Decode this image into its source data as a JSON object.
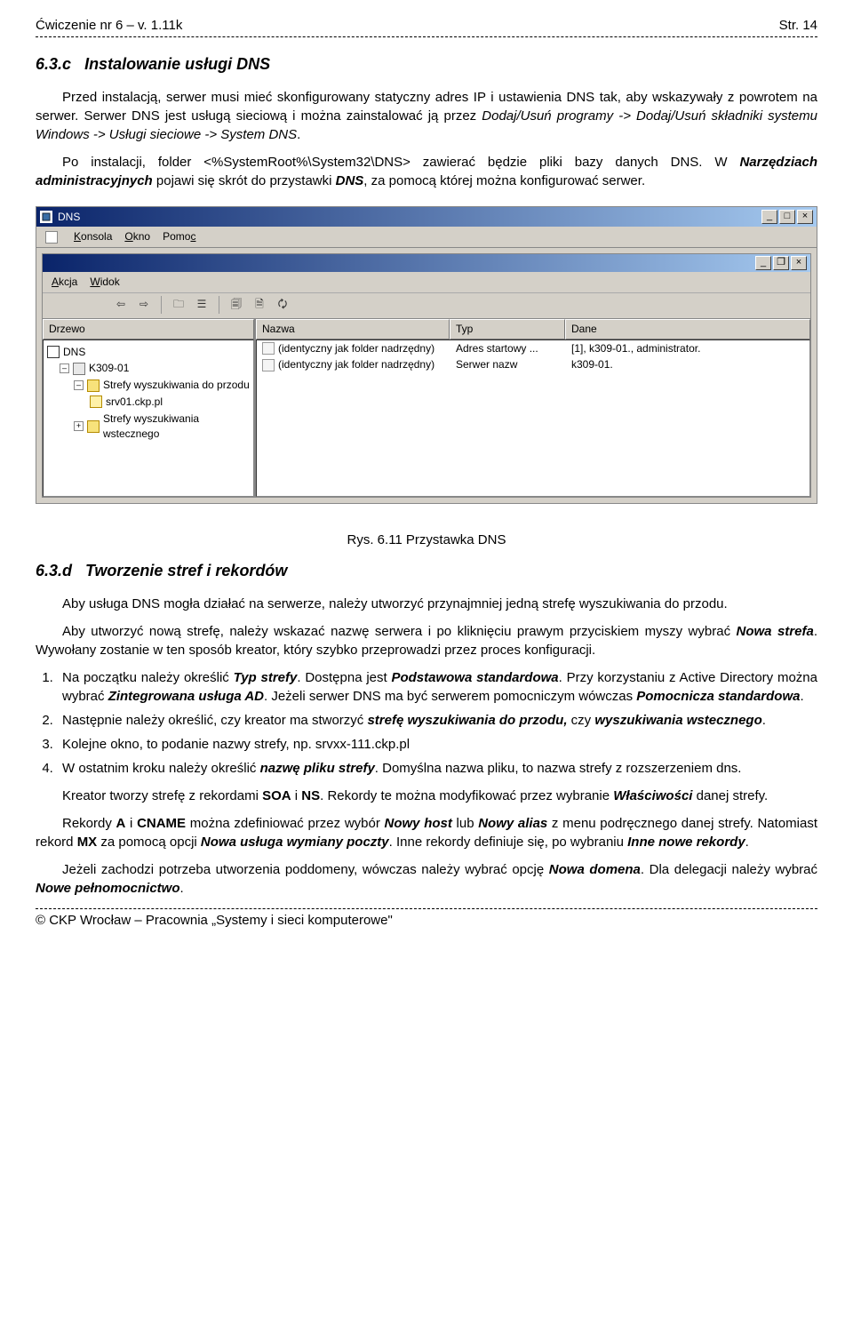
{
  "header": {
    "left": "Ćwiczenie nr 6 – v. 1.11k",
    "right": "Str. 14"
  },
  "section_c": {
    "number": "6.3.c",
    "title": "Instalowanie usługi DNS",
    "p1a": "Przed instalacją, serwer musi mieć skonfigurowany statyczny adres IP i ustawienia DNS tak, aby wskazywały z powrotem na serwer. Serwer DNS jest usługą sieciową i można zainstalować ją przez ",
    "p1b": "Dodaj/Usuń programy -> Dodaj/Usuń składniki systemu Windows -> Usługi sieciowe -> System DNS",
    "p1c": ".",
    "p2a": "Po instalacji, folder <%SystemRoot%\\System32\\DNS> zawierać będzie pliki bazy danych DNS. W ",
    "p2b": "Narzędziach administracyjnych",
    "p2c": " pojawi się skrót do przystawki ",
    "p2d": "DNS",
    "p2e": ", za pomocą której można konfigurować serwer."
  },
  "window": {
    "title": "DNS",
    "menu1": {
      "konsola": "Konsola",
      "okno": "Okno",
      "pomoc": "Pomoc"
    },
    "menu2": {
      "akcja": "Akcja",
      "widok": "Widok"
    },
    "toolbar_icons": [
      "back-icon",
      "forward-icon",
      "up-icon",
      "show-hide-icon",
      "properties-icon",
      "copy-icon",
      "refresh-icon",
      "help-icon"
    ],
    "left_header": "Drzewo",
    "tree": {
      "root": "DNS",
      "server": "K309-01",
      "forward_zone_label": "Strefy wyszukiwania do przodu",
      "zone": "srv01.ckp.pl",
      "reverse_zone_label": "Strefy wyszukiwania wstecznego"
    },
    "cols": {
      "name": "Nazwa",
      "type": "Typ",
      "data": "Dane"
    },
    "rows": [
      {
        "name": "(identyczny jak folder nadrzędny)",
        "type": "Adres startowy ...",
        "data": "[1], k309-01., administrator."
      },
      {
        "name": "(identyczny jak folder nadrzędny)",
        "type": "Serwer nazw",
        "data": "k309-01."
      }
    ]
  },
  "fig_caption": "Rys. 6.11 Przystawka DNS",
  "section_d": {
    "number": "6.3.d",
    "title": "Tworzenie stref i rekordów",
    "p1": "Aby usługa DNS mogła działać na serwerze, należy utworzyć przynajmniej jedną strefę wyszukiwania do przodu.",
    "p2a": "Aby utworzyć nową strefę, należy wskazać nazwę serwera i po kliknięciu prawym przyciskiem myszy wybrać ",
    "p2b": "Nowa strefa",
    "p2c": ". Wywołany zostanie w ten sposób kreator, który szybko przeprowadzi przez proces konfiguracji.",
    "li1a": "Na początku należy określić ",
    "li1b": "Typ strefy",
    "li1c": ". Dostępna jest ",
    "li1d": "Podstawowa standardowa",
    "li1e": ". Przy korzystaniu z Active Directory można wybrać ",
    "li1f": "Zintegrowana usługa AD",
    "li1g": ". Jeżeli serwer DNS ma być serwerem pomocniczym wówczas ",
    "li1h": "Pomocnicza standardowa",
    "li1i": ".",
    "li2a": "Następnie należy określić, czy kreator ma stworzyć ",
    "li2b": "strefę wyszukiwania do przodu,",
    "li2c": " czy ",
    "li2d": "wyszukiwania wstecznego",
    "li2e": ".",
    "li3": "Kolejne okno, to podanie nazwy strefy, np. srvxx-111.ckp.pl",
    "li4a": "W ostatnim kroku należy określić ",
    "li4b": "nazwę pliku strefy",
    "li4c": ". Domyślna nazwa pliku, to nazwa strefy z rozszerzeniem dns.",
    "p3a": "Kreator tworzy strefę z rekordami ",
    "p3b": "SOA",
    "p3c": " i ",
    "p3d": "NS",
    "p3e": ". Rekordy te można modyfikować przez wybranie ",
    "p3f": "Właściwości",
    "p3g": " danej strefy.",
    "p4a": "Rekordy ",
    "p4b": "A",
    "p4c": " i ",
    "p4d": "CNAME",
    "p4e": " można zdefiniować przez wybór ",
    "p4f": "Nowy host",
    "p4g": " lub ",
    "p4h": "Nowy alias",
    "p4i": " z menu podręcznego danej strefy. Natomiast rekord ",
    "p4j": "MX",
    "p4k": " za pomocą opcji ",
    "p4l": "Nowa usługa wymiany poczty",
    "p4m": ". Inne rekordy definiuje się, po wybraniu ",
    "p4n": "Inne nowe rekordy",
    "p4o": ".",
    "p5a": "Jeżeli zachodzi potrzeba utworzenia poddomeny, wówczas należy wybrać opcję ",
    "p5b": "Nowa domena",
    "p5c": ". Dla delegacji należy wybrać ",
    "p5d": "Nowe pełnomocnictwo",
    "p5e": "."
  },
  "footer": "© CKP Wrocław – Pracownia „Systemy i sieci komputerowe\""
}
